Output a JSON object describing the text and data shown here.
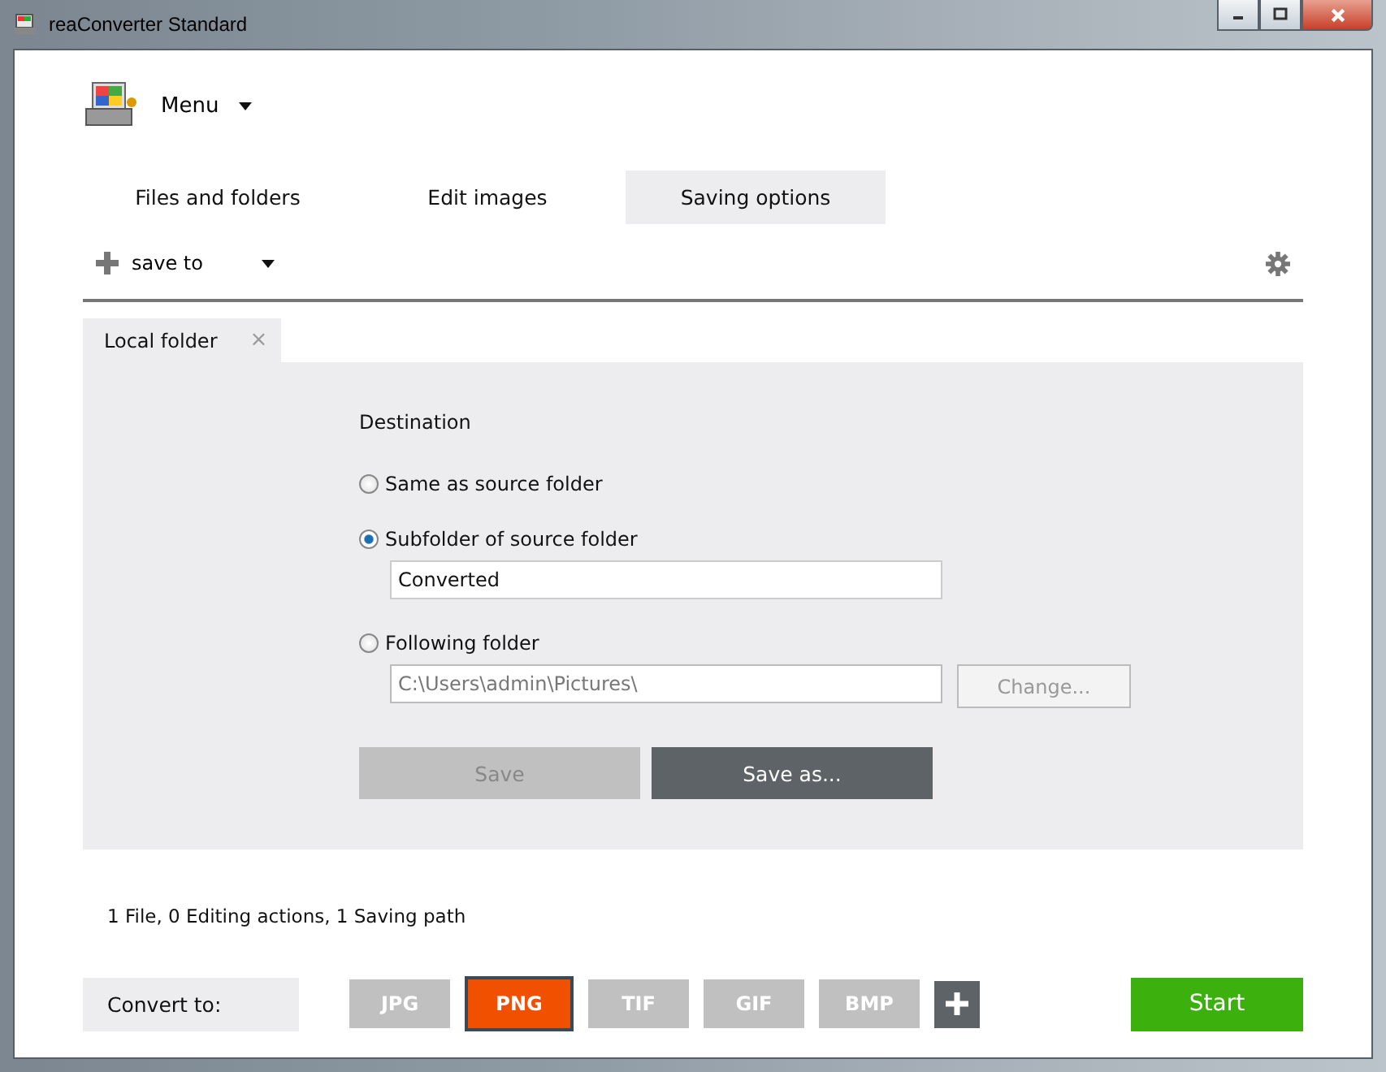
{
  "window": {
    "title": "reaConverter Standard"
  },
  "menu": {
    "label": "Menu"
  },
  "tabs": [
    {
      "label": "Files and folders",
      "selected": false
    },
    {
      "label": "Edit images",
      "selected": false
    },
    {
      "label": "Saving options",
      "selected": true
    }
  ],
  "toolbar": {
    "label": "save to"
  },
  "subtabs": [
    {
      "label": "Local folder",
      "selected": true,
      "close": "×"
    }
  ],
  "destination": {
    "heading": "Destination",
    "options": [
      {
        "label": "Same as source folder",
        "selected": false
      },
      {
        "label": "Subfolder of source folder",
        "selected": true,
        "field": {
          "value": "Converted",
          "disabled": false
        }
      },
      {
        "label": "Following folder",
        "selected": false,
        "field": {
          "value": "C:\\Users\\admin\\Pictures\\",
          "disabled": true
        },
        "button": {
          "label": "Change...",
          "disabled": true
        }
      }
    ],
    "buttons": [
      {
        "label": "Save",
        "disabled": true
      },
      {
        "label": "Save as...",
        "disabled": false
      }
    ]
  },
  "summary": "1 File, 0 Editing actions, 1 Saving path",
  "convert_label": "Convert to:",
  "formats": [
    {
      "label": "JPG",
      "selected": false
    },
    {
      "label": "PNG",
      "selected": true
    },
    {
      "label": "TIF",
      "selected": false
    },
    {
      "label": "GIF",
      "selected": false
    },
    {
      "label": "BMP",
      "selected": false
    }
  ],
  "start": "Start"
}
